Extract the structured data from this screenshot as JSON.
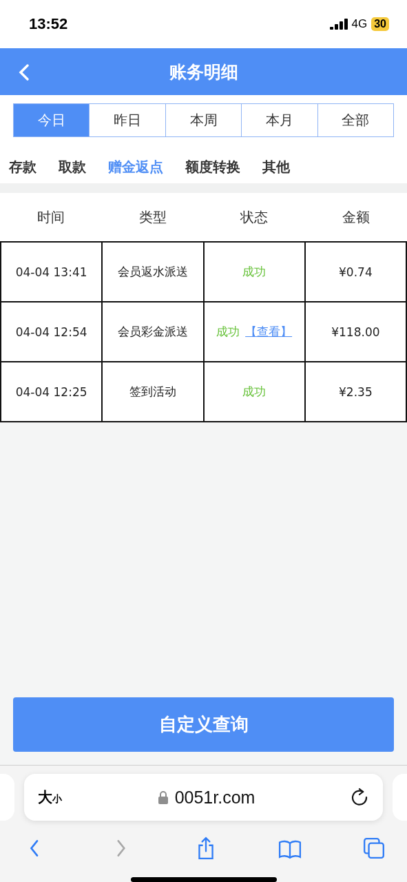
{
  "status_bar": {
    "time": "13:52",
    "network": "4G",
    "battery": "30",
    "low_power": true
  },
  "header": {
    "title": "账务明细"
  },
  "periods": [
    {
      "label": "今日",
      "selected": true
    },
    {
      "label": "昨日",
      "selected": false
    },
    {
      "label": "本周",
      "selected": false
    },
    {
      "label": "本月",
      "selected": false
    },
    {
      "label": "全部",
      "selected": false
    }
  ],
  "categories": [
    {
      "label": "存款",
      "selected": false
    },
    {
      "label": "取款",
      "selected": false
    },
    {
      "label": "赠金返点",
      "selected": true
    },
    {
      "label": "额度转换",
      "selected": false
    },
    {
      "label": "其他",
      "selected": false
    }
  ],
  "table": {
    "columns": [
      "时间",
      "类型",
      "状态",
      "金额"
    ],
    "rows": [
      {
        "time": "04-04 13:41",
        "type": "会员返水派送",
        "status": {
          "text": "成功",
          "kind": "success"
        },
        "amount": "¥0.74"
      },
      {
        "time": "04-04 12:54",
        "type": "会员彩金派送",
        "status": {
          "text": "成功",
          "kind": "success",
          "link": "【查看】"
        },
        "amount": "¥118.00"
      },
      {
        "time": "04-04 12:25",
        "type": "签到活动",
        "status": {
          "text": "成功",
          "kind": "success"
        },
        "amount": "¥2.35"
      }
    ]
  },
  "query_button": "自定义查询",
  "browser": {
    "text_size": {
      "large": "大",
      "small": "小"
    },
    "url": "0051r.com",
    "toolbar": [
      {
        "kind": "back",
        "disabled": false
      },
      {
        "kind": "forward",
        "disabled": true
      },
      {
        "kind": "share",
        "disabled": false
      },
      {
        "kind": "bookmarks",
        "disabled": false
      },
      {
        "kind": "tabs",
        "disabled": false
      }
    ]
  }
}
